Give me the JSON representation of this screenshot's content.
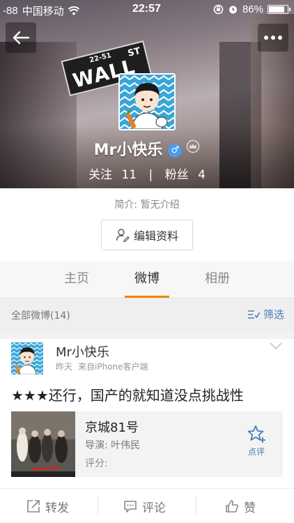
{
  "status_bar": {
    "signal": "-88",
    "carrier": "中国移动",
    "time": "22:57",
    "battery": "86%",
    "battery_level": 0.86
  },
  "header": {
    "back_icon": "back-arrow-icon",
    "more_icon": "more-dots-icon",
    "cover_sign": {
      "number": "22-51",
      "name": "WALL",
      "suffix": "ST"
    }
  },
  "profile": {
    "name": "Mr小快乐",
    "gender_icon": "male-icon",
    "level_icon": "crown-icon",
    "following_label": "关注",
    "following_count": "11",
    "divider": "|",
    "followers_label": "粉丝",
    "followers_count": "4",
    "bio": "简介: 暂无介绍",
    "edit_label": "编辑资料"
  },
  "tabs": [
    {
      "label": "主页",
      "active": false
    },
    {
      "label": "微博",
      "active": true
    },
    {
      "label": "相册",
      "active": false
    }
  ],
  "filter_bar": {
    "count_label": "全部微博(14)",
    "filter_label": "筛选"
  },
  "post": {
    "author": "Mr小快乐",
    "time": "昨天",
    "source": "来自iPhone客户端",
    "content": "★★★还行，国产的就知道没点挑战性",
    "film": {
      "title": "京城81号",
      "director": "导演: 叶伟民",
      "rating_label": "评分:",
      "rate_label": "点评"
    }
  },
  "actions": {
    "repost": "转发",
    "comment": "评论",
    "like": "赞"
  },
  "colors": {
    "accent": "#f08300",
    "link": "#4a7ab8",
    "avatar_bg": "#3aa6d8"
  }
}
